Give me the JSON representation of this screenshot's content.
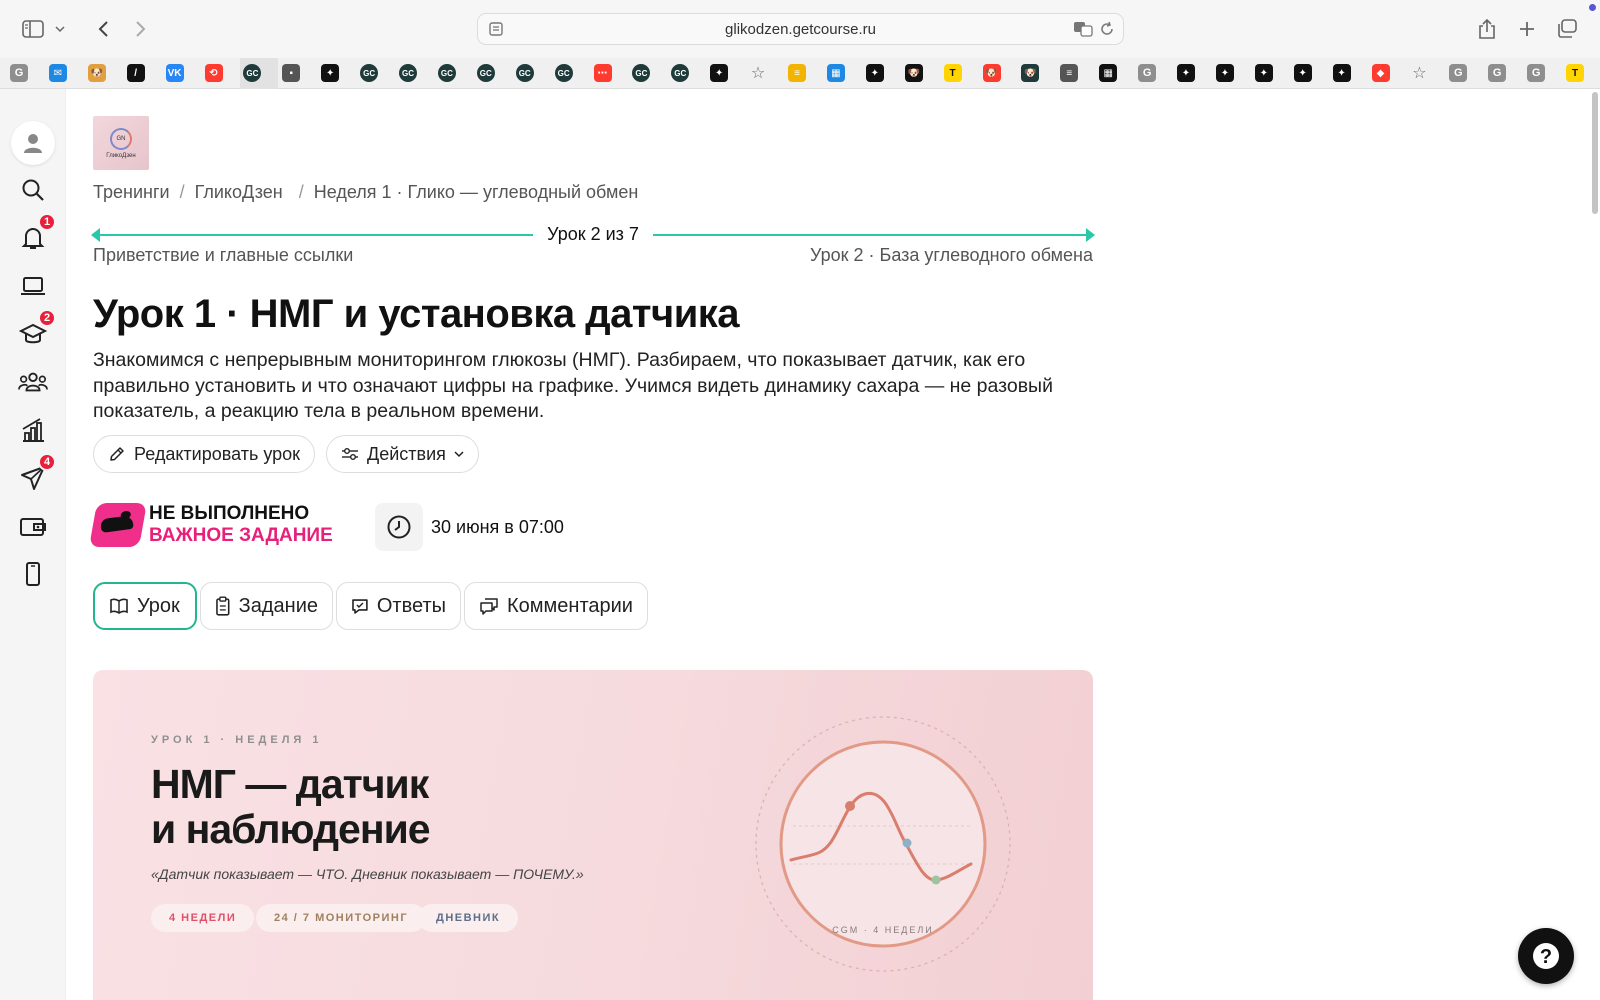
{
  "browser": {
    "url": "glikodzen.getcourse.ru",
    "favorites": [
      "G",
      "✉",
      "🐶",
      "/",
      "VK",
      "⟲",
      "GC",
      "▪",
      "✦",
      "GC",
      "GC",
      "GC",
      "GC",
      "GC",
      "GC",
      "⋯",
      "GC",
      "GC",
      "✦",
      "☆",
      "≡",
      "▦",
      "✦",
      "🐶",
      "T",
      "🐶",
      "🐶",
      "≡",
      "▦",
      "G",
      "✦",
      "✦",
      "✦",
      "✦",
      "✦",
      "◆",
      "☆",
      "G",
      "G",
      "G",
      "T"
    ]
  },
  "sidebar": {
    "badges": {
      "notifications": "1",
      "trainings": "2",
      "messages": "4"
    }
  },
  "school": {
    "logo_text": "ГликоДзен",
    "logo_mark": "GN"
  },
  "breadcrumb": {
    "items": [
      "Тренинги",
      "ГликоДзен",
      "Неделя 1 · Глико — углеводный обмен"
    ]
  },
  "lesson_nav": {
    "counter": "Урок 2 из 7",
    "prev": "Приветствие и главные ссылки",
    "next": "Урок 2 · База углеводного обмена"
  },
  "lesson": {
    "title": "Урок 1 · НМГ и установка датчика",
    "description": "Знакомимся с непрерывным мониторингом глюкозы (НМГ). Разбираем, что показывает датчик, как его правильно установить и что означают цифры на графике. Учимся видеть динамику сахара — не разовый показатель, а реакцию тела в реальном времени."
  },
  "actions": {
    "edit": "Редактировать урок",
    "more": "Действия"
  },
  "status": {
    "line1": "НЕ ВЫПОЛНЕНО",
    "line2": "ВАЖНОЕ ЗАДАНИЕ",
    "accent": "#e8207a"
  },
  "deadline": "30 июня в 07:00",
  "tabs": [
    "Урок",
    "Задание",
    "Ответы",
    "Комментарии"
  ],
  "hero": {
    "eyebrow": "УРОК 1 · НЕДЕЛЯ 1",
    "title_line1": "НМГ — датчик",
    "title_line2": "и наблюдение",
    "quote": "«Датчик показывает — ЧТО. Дневник показывает — ПОЧЕМУ.»",
    "tags": [
      {
        "label": "4 НЕДЕЛИ",
        "color": "#e0506a"
      },
      {
        "label": "24 / 7 МОНИТОРИНГ",
        "color": "#a08060"
      },
      {
        "label": "ДНЕВНИК",
        "color": "#5d6e8a"
      }
    ],
    "chart_caption": "CGM · 4 НЕДЕЛИ"
  },
  "colors": {
    "accent": "#28c8a8",
    "badge": "#e8203c"
  }
}
